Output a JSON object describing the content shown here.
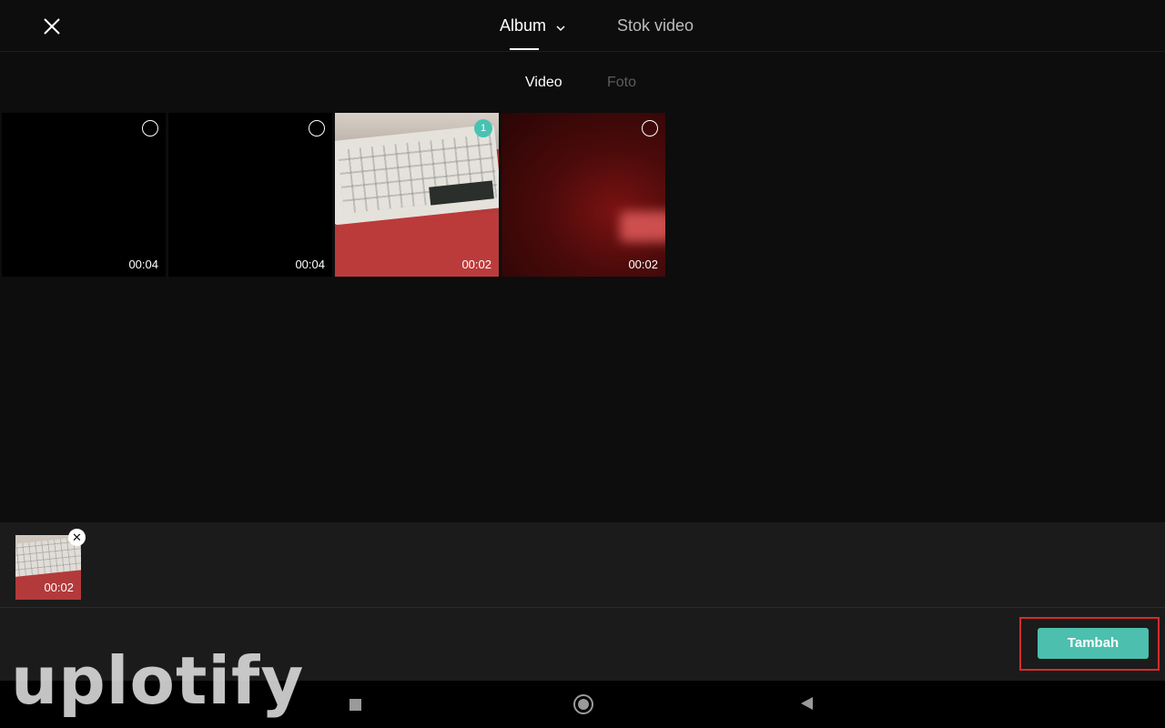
{
  "header": {
    "close_icon": "close-icon",
    "tabs": [
      {
        "label": "Album",
        "active": true,
        "icon": "chevron-down-icon"
      },
      {
        "label": "Stok video",
        "active": false
      }
    ]
  },
  "subtabs": [
    {
      "label": "Video",
      "active": true
    },
    {
      "label": "Foto",
      "active": false
    }
  ],
  "media_grid": {
    "items": [
      {
        "duration": "00:04",
        "selected": false,
        "thumbnail": "black"
      },
      {
        "duration": "00:04",
        "selected": false,
        "thumbnail": "black"
      },
      {
        "duration": "00:02",
        "selected": true,
        "selection_number": "1",
        "thumbnail": "keyboard"
      },
      {
        "duration": "00:02",
        "selected": false,
        "thumbnail": "red-blur"
      }
    ]
  },
  "selection_tray": {
    "items": [
      {
        "duration": "00:02",
        "remove_icon": "close-icon"
      }
    ]
  },
  "actions": {
    "add_label": "Tambah"
  },
  "colors": {
    "accent": "#4cbfae",
    "highlight_border": "#d62b2b",
    "background": "#0d0d0d"
  },
  "watermark": {
    "text": "uplotify"
  },
  "system_nav": [
    "recents-icon",
    "home-icon",
    "back-icon"
  ]
}
